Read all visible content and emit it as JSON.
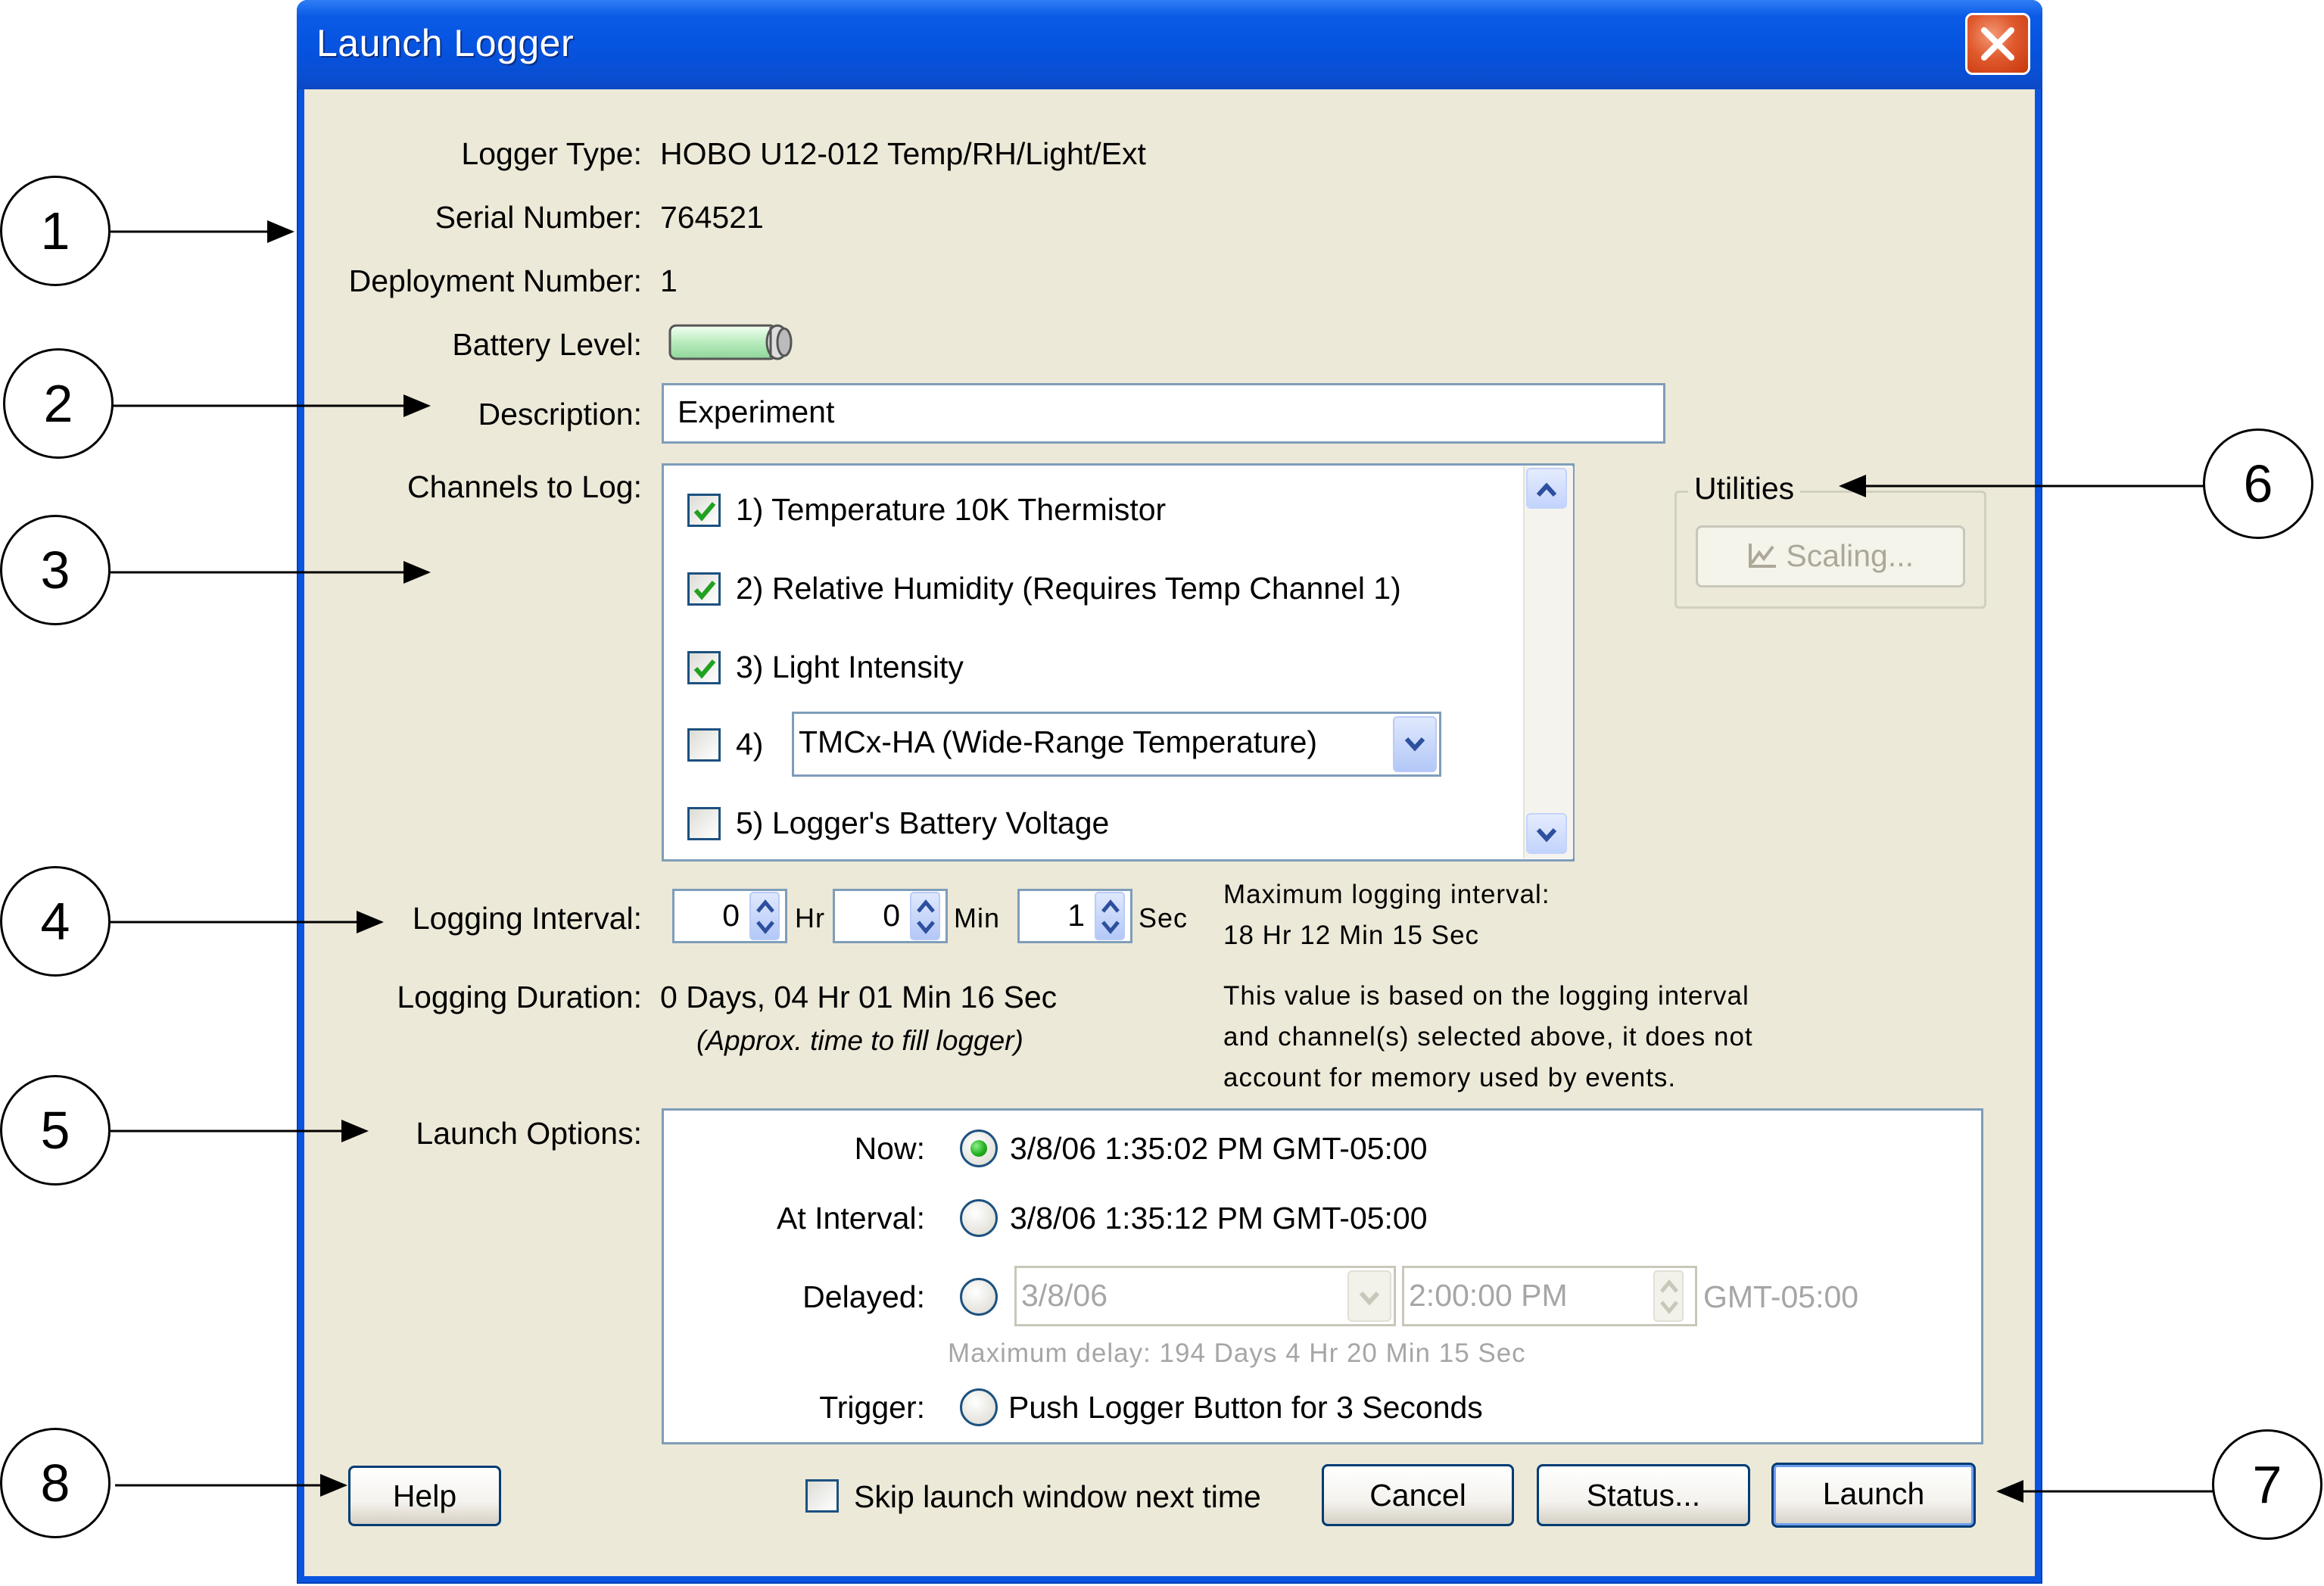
{
  "window": {
    "title": "Launch Logger"
  },
  "info": {
    "logger_type_label": "Logger Type:",
    "logger_type_value": "HOBO U12-012 Temp/RH/Light/Ext",
    "serial_label": "Serial Number:",
    "serial_value": "764521",
    "deployment_label": "Deployment Number:",
    "deployment_value": "1",
    "battery_label": "Battery Level:",
    "battery_level": 1.0
  },
  "description": {
    "label": "Description:",
    "value": "Experiment"
  },
  "channels": {
    "label": "Channels to Log:",
    "items": [
      {
        "label": "1) Temperature 10K Thermistor",
        "checked": true
      },
      {
        "label": "2) Relative Humidity (Requires Temp Channel 1)",
        "checked": true
      },
      {
        "label": "3) Light Intensity",
        "checked": true
      },
      {
        "label": "4)",
        "checked": false,
        "select_value": "TMCx-HA (Wide-Range Temperature)"
      },
      {
        "label": "5) Logger's Battery Voltage",
        "checked": false
      }
    ]
  },
  "utilities": {
    "group_label": "Utilities",
    "scaling_button": "Scaling..."
  },
  "logging_interval": {
    "label": "Logging Interval:",
    "hours": "0",
    "hours_unit": "Hr",
    "minutes": "0",
    "minutes_unit": "Min",
    "seconds": "1",
    "seconds_unit": "Sec",
    "max_label": "Maximum logging interval:",
    "max_value": "18 Hr 12 Min 15 Sec"
  },
  "logging_duration": {
    "label": "Logging Duration:",
    "value": "0 Days, 04 Hr 01 Min 16 Sec",
    "note": "(Approx. time to fill logger)",
    "explain_line1": "This value is based on the logging interval",
    "explain_line2": "and channel(s) selected above, it does not",
    "explain_line3": "account for memory used by events."
  },
  "launch_options": {
    "label": "Launch Options:",
    "now_label": "Now:",
    "now_value": "3/8/06 1:35:02 PM GMT-05:00",
    "interval_label": "At Interval:",
    "interval_value": "3/8/06 1:35:12 PM GMT-05:00",
    "delayed_label": "Delayed:",
    "delayed_date": "3/8/06",
    "delayed_time": "2:00:00 PM",
    "delayed_tz": "GMT-05:00",
    "max_delay": "Maximum delay: 194 Days  4 Hr 20 Min 15 Sec",
    "trigger_label": "Trigger:",
    "trigger_value": "Push Logger Button for 3 Seconds",
    "selected": "now"
  },
  "footer": {
    "help_button": "Help",
    "skip_label": "Skip launch window next time",
    "skip_checked": false,
    "cancel_button": "Cancel",
    "status_button": "Status...",
    "launch_button": "Launch"
  },
  "callouts": [
    "1",
    "2",
    "3",
    "4",
    "5",
    "6",
    "7",
    "8"
  ],
  "colors": {
    "title_bar": "#0553df",
    "client_bg": "#ece9d8",
    "close_button": "#e05a2e",
    "checkmark": "#21a121",
    "radio_dot": "#22b01f"
  }
}
